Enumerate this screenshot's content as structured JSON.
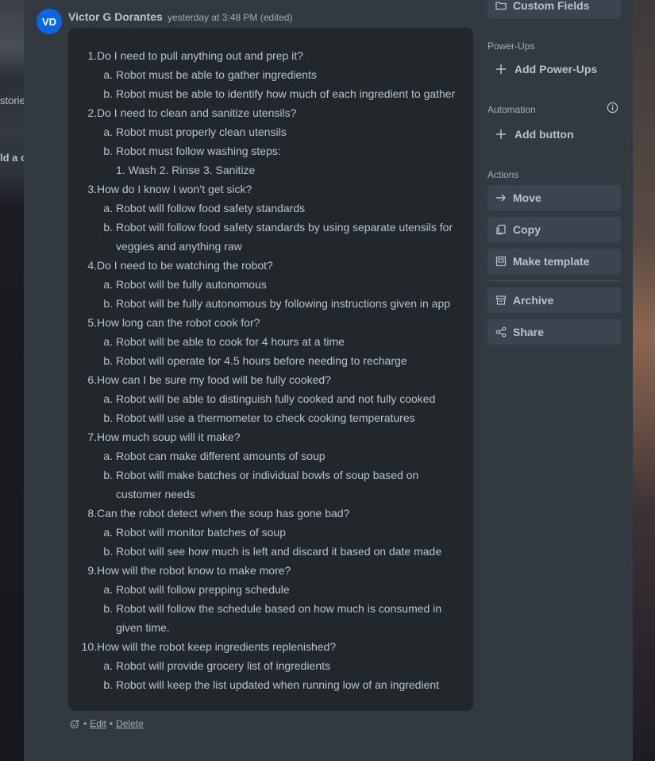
{
  "background": {
    "left_fragments": [
      "storie",
      "ld a c"
    ]
  },
  "comment": {
    "avatar_initials": "VD",
    "author": "Victor G Dorantes",
    "timestamp": "yesterday at 3:48 PM (edited)",
    "lines": [
      {
        "marker": "1.",
        "text": "Do I need to pull anything out and prep it?",
        "level": 0
      },
      {
        "marker": "a.",
        "text": "Robot must be able to gather ingredients",
        "level": 1
      },
      {
        "marker": "b.",
        "text": "Robot must be able to identify how much of each ingredient to gather",
        "level": 1
      },
      {
        "marker": "2.",
        "text": "Do I need to clean and sanitize utensils?",
        "level": 0
      },
      {
        "marker": "a.",
        "text": "Robot must properly clean utensils",
        "level": 1
      },
      {
        "marker": "b.",
        "text": "Robot must follow washing steps:",
        "level": 1
      },
      {
        "marker": "",
        "text": "1. Wash 2. Rinse 3. Sanitize",
        "level": 2
      },
      {
        "marker": "3.",
        "text": "How do I know I won’t get sick?",
        "level": 0
      },
      {
        "marker": "a.",
        "text": "Robot will follow food safety standards",
        "level": 1
      },
      {
        "marker": "b.",
        "text": "Robot will follow food safety standards by using separate utensils for",
        "level": 1
      },
      {
        "marker": "",
        "text": "veggies and anything raw",
        "level": 1
      },
      {
        "marker": "4.",
        "text": "Do I need to be watching the robot?",
        "level": 0
      },
      {
        "marker": "a.",
        "text": "Robot will be fully autonomous",
        "level": 1
      },
      {
        "marker": "b.",
        "text": "Robot will be fully autonomous by following instructions given in app",
        "level": 1
      },
      {
        "marker": "5.",
        "text": "How long can the robot cook for?",
        "level": 0
      },
      {
        "marker": "a.",
        "text": "Robot will be able to cook for 4 hours at a time",
        "level": 1
      },
      {
        "marker": "b.",
        "text": "Robot will operate for 4.5 hours before needing to recharge",
        "level": 1
      },
      {
        "marker": "6.",
        "text": "How can I be sure my food will be fully cooked?",
        "level": 0
      },
      {
        "marker": "a.",
        "text": "Robot will be able to distinguish fully cooked and not fully cooked",
        "level": 1
      },
      {
        "marker": "b.",
        "text": "Robot will use a thermometer to check cooking temperatures",
        "level": 1
      },
      {
        "marker": "7.",
        "text": "How much soup will it make?",
        "level": 0
      },
      {
        "marker": "a.",
        "text": "Robot can make different amounts of soup",
        "level": 1
      },
      {
        "marker": "b.",
        "text": "Robot will make batches or individual bowls of soup based on",
        "level": 1
      },
      {
        "marker": "",
        "text": "customer needs",
        "level": 1
      },
      {
        "marker": "8.",
        "text": "Can the robot detect when the soup has gone bad?",
        "level": 0
      },
      {
        "marker": "a.",
        "text": "Robot will monitor batches of soup",
        "level": 1
      },
      {
        "marker": "b.",
        "text": "Robot will see how much is left and discard it based on date made",
        "level": 1
      },
      {
        "marker": "9.",
        "text": "How will the robot know to make more?",
        "level": 0
      },
      {
        "marker": "a.",
        "text": "Robot will follow prepping schedule",
        "level": 1
      },
      {
        "marker": "b.",
        "text": "Robot will follow the schedule based on how much is consumed in",
        "level": 1
      },
      {
        "marker": "",
        "text": "given time.",
        "level": 1
      },
      {
        "marker": "10.",
        "text": "How will the robot keep ingredients replenished?",
        "level": 0
      },
      {
        "marker": "a.",
        "text": "Robot will provide grocery list of ingredients",
        "level": 1
      },
      {
        "marker": "b.",
        "text": "Robot will keep the list updated when running low of an ingredient",
        "level": 1
      }
    ],
    "edit_label": "Edit",
    "delete_label": "Delete",
    "separator": "•"
  },
  "sidebar": {
    "custom_fields": "Custom Fields",
    "powerups_heading": "Power-Ups",
    "add_powerups": "Add Power-Ups",
    "automation_heading": "Automation",
    "add_button": "Add button",
    "actions_heading": "Actions",
    "actions": [
      {
        "label": "Move",
        "icon": "arrow-right-icon"
      },
      {
        "label": "Copy",
        "icon": "copy-icon"
      },
      {
        "label": "Make template",
        "icon": "template-icon"
      },
      {
        "label": "Archive",
        "icon": "archive-icon"
      },
      {
        "label": "Share",
        "icon": "share-icon"
      }
    ]
  },
  "colors": {
    "panel": "#323940",
    "comment_bg": "#22272b",
    "avatar": "#0c66e4",
    "text": "#b6c2cf",
    "button_bg": "#3b4450"
  }
}
